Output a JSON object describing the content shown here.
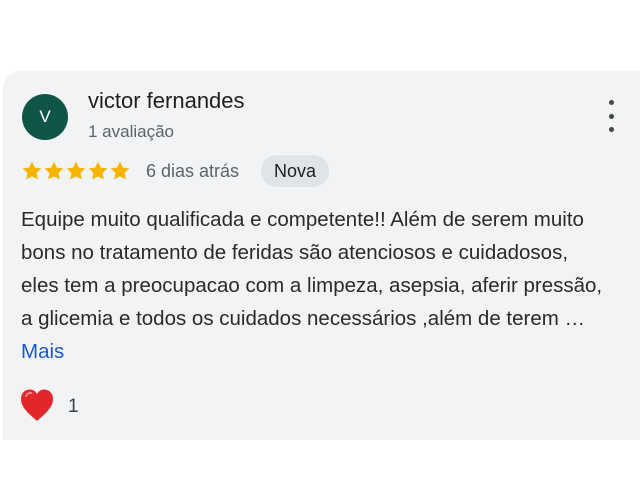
{
  "reviewer": {
    "initial": "V",
    "name": "victor fernandes",
    "review_count": "1 avaliação"
  },
  "rating": {
    "stars": 5,
    "max": 5,
    "star_color": "#f5b400",
    "time_ago": "6 dias atrás",
    "badge": "Nova"
  },
  "review": {
    "text": "Equipe muito qualificada e competente!! Além de serem muito bons no tratamento de feridas são atenciosos e cuidadosos, eles tem a preocupacao com a limpeza, asepsia, aferir pressão, a glicemia e todos os cuidados necessários ,além de terem …",
    "more_label": "Mais"
  },
  "reactions": {
    "icon": "heart-icon",
    "count": "1"
  },
  "colors": {
    "avatar_bg": "#0f5548",
    "link": "#1a58c7",
    "card_bg": "#f1f3f5"
  }
}
